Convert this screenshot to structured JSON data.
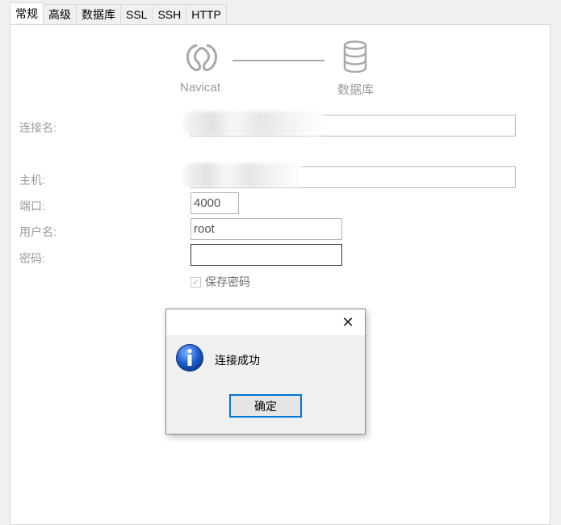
{
  "tabs": [
    {
      "label": "常规",
      "active": true
    },
    {
      "label": "高级"
    },
    {
      "label": "数据库"
    },
    {
      "label": "SSL"
    },
    {
      "label": "SSH"
    },
    {
      "label": "HTTP"
    }
  ],
  "flow": {
    "left_label": "Navicat",
    "right_label": "数据库",
    "left_icon": "navicat-logo-icon",
    "right_icon": "database-icon"
  },
  "form": {
    "connection_name_label": "连接名:",
    "connection_name_value": "",
    "host_label": "主机:",
    "host_value": "",
    "port_label": "端口:",
    "port_value": "4000",
    "username_label": "用户名:",
    "username_value": "root",
    "password_label": "密码:",
    "password_value": "",
    "save_password_label": "保存密码",
    "save_password_checked": true
  },
  "dialog": {
    "message": "连接成功",
    "ok_label": "确定",
    "close_icon": "close-icon",
    "info_icon": "info-icon"
  },
  "colors": {
    "accent": "#0078d7",
    "label_gray": "#9a9a9a"
  }
}
